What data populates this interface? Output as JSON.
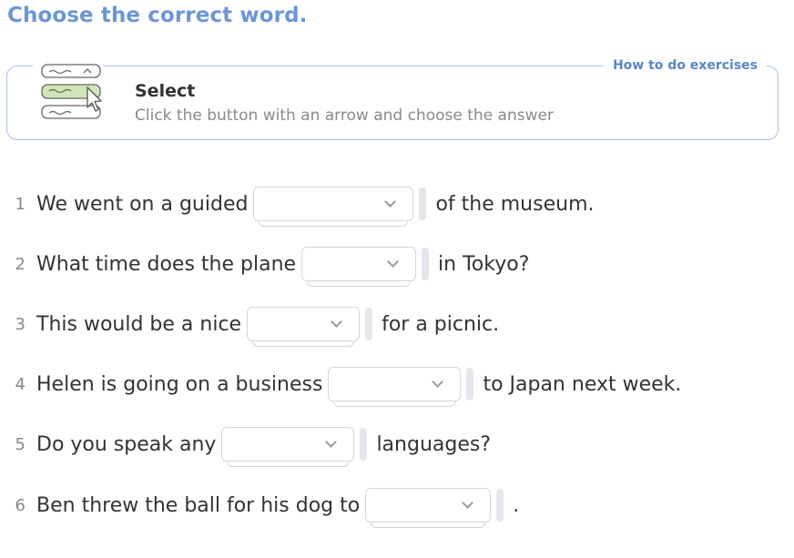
{
  "page": {
    "title": "Choose the correct word."
  },
  "howto": {
    "link_label": "How to do exercises",
    "heading": "Select",
    "text": "Click the button with an arrow and choose the answer",
    "icon": "select-dropdown-icon"
  },
  "questions": [
    {
      "num": "1",
      "before": "We went on a guided",
      "after": "of the museum.",
      "selected": ""
    },
    {
      "num": "2",
      "before": "What time does the plane",
      "after": "in Tokyo?",
      "selected": ""
    },
    {
      "num": "3",
      "before": "This would be a nice",
      "after": "for a picnic.",
      "selected": ""
    },
    {
      "num": "4",
      "before": "Helen is going on a business",
      "after": "to Japan next week.",
      "selected": ""
    },
    {
      "num": "5",
      "before": "Do you speak any",
      "after": "languages?",
      "selected": ""
    },
    {
      "num": "6",
      "before": "Ben threw the ball for his dog to",
      "after": ".",
      "selected": ""
    }
  ]
}
